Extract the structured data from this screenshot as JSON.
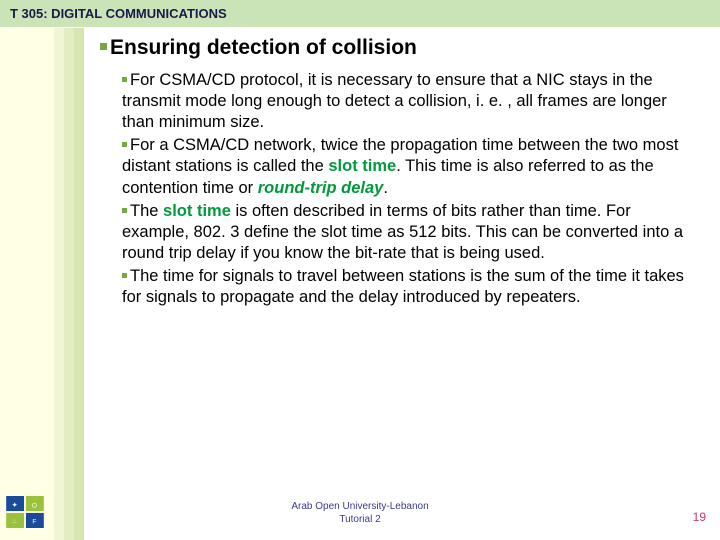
{
  "title": "T 305: DIGITAL COMMUNICATIONS",
  "heading": "Ensuring detection of collision",
  "bullets": {
    "b1": {
      "pre": "For CSMA/CD protocol, it is necessary to ensure that a NIC stays in the transmit mode long enough to detect a collision, i. e. , all frames are longer than minimum size."
    },
    "b2": {
      "pre": "For a CSMA/CD network, twice the propagation time between the two most distant stations is called the ",
      "slot": "slot time",
      "mid": ". This time is also referred to as the contention time or ",
      "rtd": "round-trip delay",
      "post": "."
    },
    "b3": {
      "pre": "The ",
      "slot": "slot time",
      "mid": " is often described in terms of bits rather than time. For example, 802. 3 define the slot time as 512 bits. This can be converted into a round trip delay if you know the bit-rate that is being used."
    },
    "b4": {
      "pre": "The time for signals to travel between stations is the sum of the time it takes for signals to propagate and the delay introduced by repeaters."
    }
  },
  "footer": {
    "line1": "Arab Open University-Lebanon",
    "line2": "Tutorial 2"
  },
  "page": "19"
}
